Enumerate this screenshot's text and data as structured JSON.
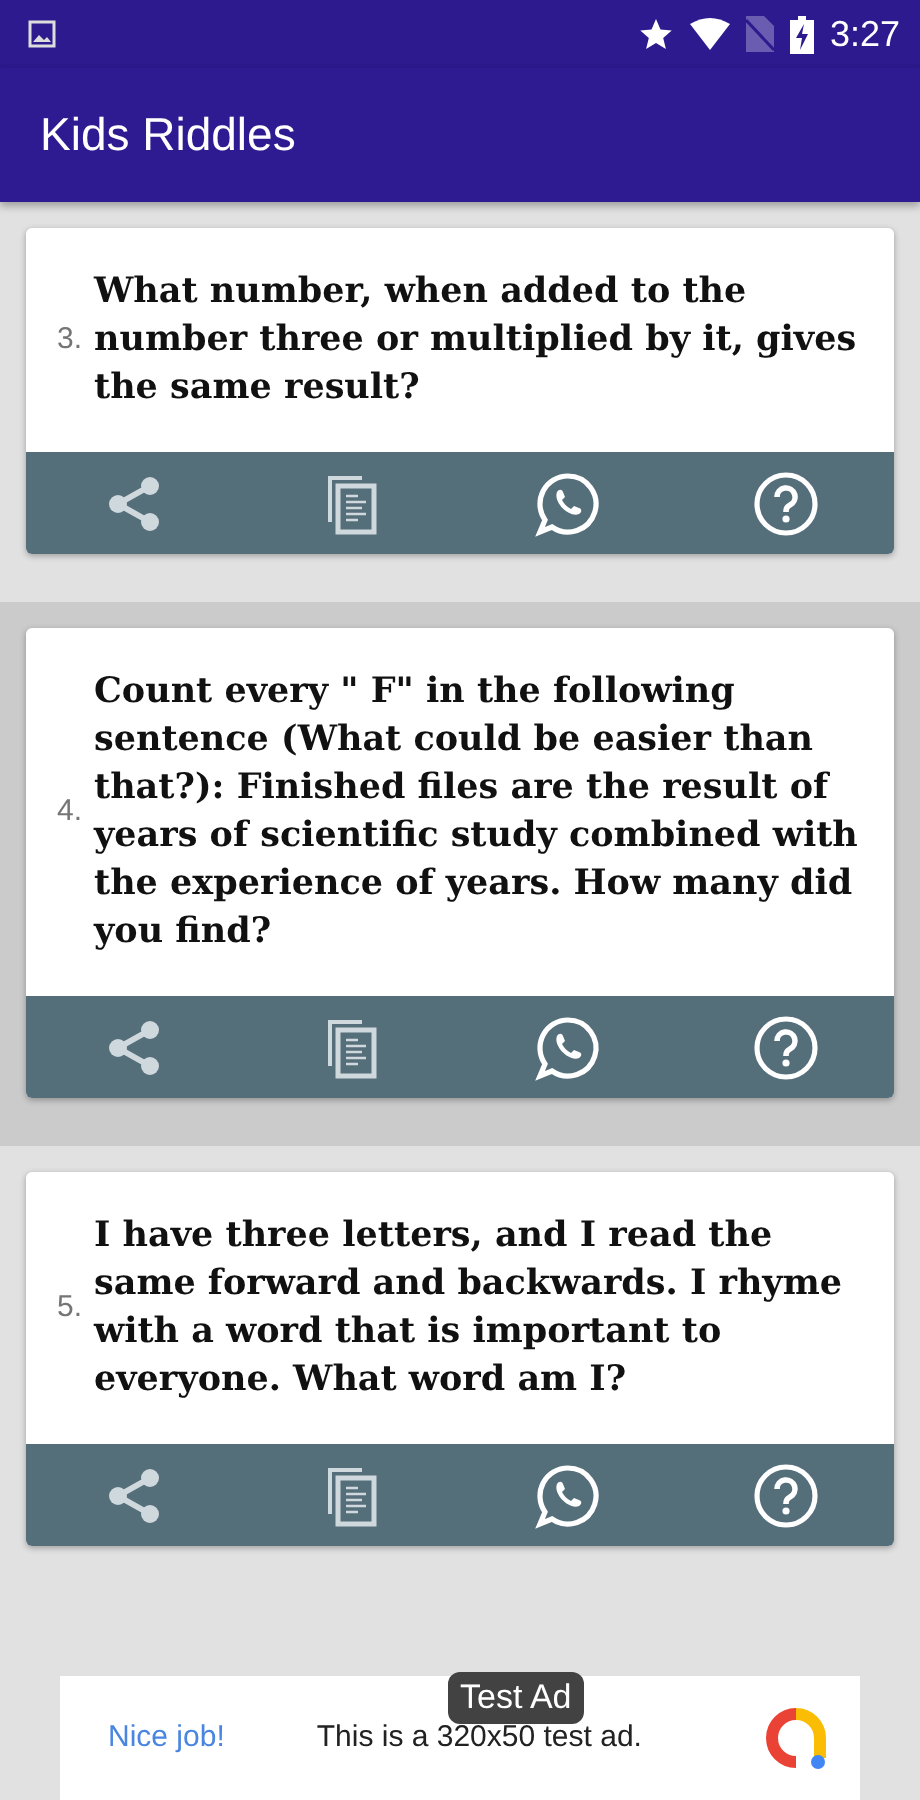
{
  "status_bar": {
    "time": "3:27"
  },
  "app_bar": {
    "title": "Kids Riddles"
  },
  "riddles": [
    {
      "number": "3.",
      "text": "What number, when added to the number three or multiplied by it, gives the same result?",
      "selected": false
    },
    {
      "number": "4.",
      "text": "Count every \" F\" in the following sentence (What could be easier than that?): Finished files are the result of years of scientific study combined with the experience of years. How many did you find?",
      "selected": true
    },
    {
      "number": "5.",
      "text": "I have three letters, and I read the same forward and backwards. I rhyme with a word that is important to everyone. What word am I?",
      "selected": false
    }
  ],
  "ad": {
    "label": "Test Ad",
    "headline": "Nice job!",
    "body": "This is a 320x50 test ad."
  }
}
